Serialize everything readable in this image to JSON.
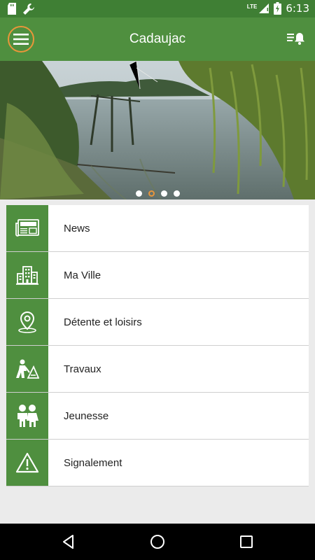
{
  "status_bar": {
    "time": "6:13",
    "network": "LTE",
    "icons": [
      "sd-card-icon",
      "wrench-icon",
      "signal-icon",
      "battery-charging-icon"
    ]
  },
  "app_bar": {
    "title": "Cadaujac",
    "menu_icon": "hamburger-menu-icon",
    "notification_icon": "notification-list-icon",
    "accent_color": "#e9963a",
    "primary_color": "#4f8f3f"
  },
  "carousel": {
    "slide_count": 4,
    "active_index": 1
  },
  "menu": {
    "items": [
      {
        "label": "News",
        "icon": "newspaper-icon"
      },
      {
        "label": "Ma Ville",
        "icon": "city-buildings-icon"
      },
      {
        "label": "Détente et loisirs",
        "icon": "location-pin-icon"
      },
      {
        "label": "Travaux",
        "icon": "roadwork-icon"
      },
      {
        "label": "Jeunesse",
        "icon": "children-icon"
      },
      {
        "label": "Signalement",
        "icon": "warning-icon"
      }
    ]
  },
  "navigation": {
    "buttons": [
      "back-icon",
      "home-icon",
      "recents-icon"
    ]
  }
}
